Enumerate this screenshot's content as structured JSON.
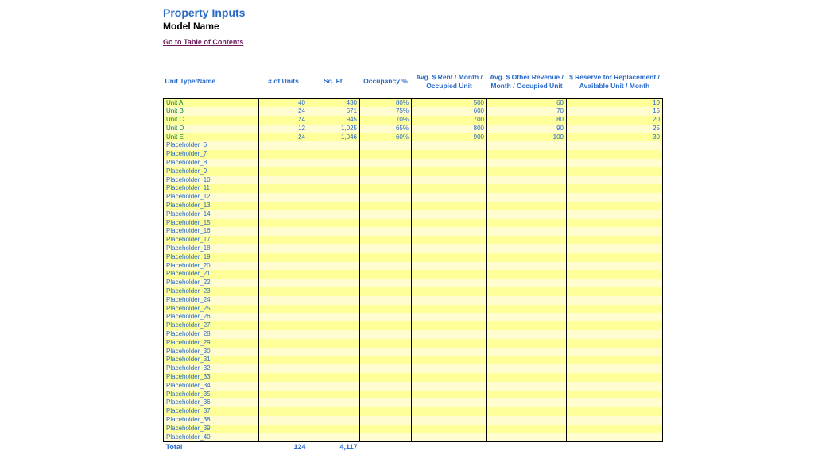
{
  "header": {
    "title": "Property Inputs",
    "subtitle": "Model Name",
    "toc_link": "Go to Table of Contents"
  },
  "columns": [
    "Unit Type/Name",
    "# of Units",
    "Sq. Ft.",
    "Occupancy %",
    "Avg. $ Rent / Month / Occupied Unit",
    "Avg. $ Other Revenue / Month / Occupied Unit",
    "$ Reserve for Replacement / Available Unit / Month"
  ],
  "rows": [
    {
      "name": "Unit A",
      "units": "40",
      "sqft": "430",
      "occ": "80%",
      "rent": "500",
      "other": "60",
      "reserve": "10",
      "is_unit": true
    },
    {
      "name": "Unit B",
      "units": "24",
      "sqft": "671",
      "occ": "75%",
      "rent": "600",
      "other": "70",
      "reserve": "15",
      "is_unit": true
    },
    {
      "name": "Unit C",
      "units": "24",
      "sqft": "945",
      "occ": "70%",
      "rent": "700",
      "other": "80",
      "reserve": "20",
      "is_unit": true
    },
    {
      "name": "Unit D",
      "units": "12",
      "sqft": "1,025",
      "occ": "65%",
      "rent": "800",
      "other": "90",
      "reserve": "25",
      "is_unit": true
    },
    {
      "name": "Unit E",
      "units": "24",
      "sqft": "1,046",
      "occ": "60%",
      "rent": "900",
      "other": "100",
      "reserve": "30",
      "is_unit": true
    },
    {
      "name": "Placeholder_6",
      "is_unit": false
    },
    {
      "name": "Placeholder_7",
      "is_unit": false
    },
    {
      "name": "Placeholder_8",
      "is_unit": false
    },
    {
      "name": "Placeholder_9",
      "is_unit": false
    },
    {
      "name": "Placeholder_10",
      "is_unit": false
    },
    {
      "name": "Placeholder_11",
      "is_unit": false
    },
    {
      "name": "Placeholder_12",
      "is_unit": false
    },
    {
      "name": "Placeholder_13",
      "is_unit": false
    },
    {
      "name": "Placeholder_14",
      "is_unit": false
    },
    {
      "name": "Placeholder_15",
      "is_unit": false
    },
    {
      "name": "Placeholder_16",
      "is_unit": false
    },
    {
      "name": "Placeholder_17",
      "is_unit": false
    },
    {
      "name": "Placeholder_18",
      "is_unit": false
    },
    {
      "name": "Placeholder_19",
      "is_unit": false
    },
    {
      "name": "Placeholder_20",
      "is_unit": false
    },
    {
      "name": "Placeholder_21",
      "is_unit": false
    },
    {
      "name": "Placeholder_22",
      "is_unit": false
    },
    {
      "name": "Placeholder_23",
      "is_unit": false
    },
    {
      "name": "Placeholder_24",
      "is_unit": false
    },
    {
      "name": "Placeholder_25",
      "is_unit": false
    },
    {
      "name": "Placeholder_26",
      "is_unit": false
    },
    {
      "name": "Placeholder_27",
      "is_unit": false
    },
    {
      "name": "Placeholder_28",
      "is_unit": false
    },
    {
      "name": "Placeholder_29",
      "is_unit": false
    },
    {
      "name": "Placeholder_30",
      "is_unit": false
    },
    {
      "name": "Placeholder_31",
      "is_unit": false
    },
    {
      "name": "Placeholder_32",
      "is_unit": false
    },
    {
      "name": "Placeholder_33",
      "is_unit": false
    },
    {
      "name": "Placeholder_34",
      "is_unit": false
    },
    {
      "name": "Placeholder_35",
      "is_unit": false
    },
    {
      "name": "Placeholder_36",
      "is_unit": false
    },
    {
      "name": "Placeholder_37",
      "is_unit": false
    },
    {
      "name": "Placeholder_38",
      "is_unit": false
    },
    {
      "name": "Placeholder_39",
      "is_unit": false
    },
    {
      "name": "Placeholder_40",
      "is_unit": false
    }
  ],
  "totals": {
    "label": "Total",
    "units": "124",
    "sqft": "4,117"
  },
  "chart_data": {
    "type": "table",
    "title": "Property Inputs",
    "columns": [
      "Unit Type/Name",
      "# of Units",
      "Sq. Ft.",
      "Occupancy %",
      "Avg. $ Rent / Month / Occupied Unit",
      "Avg. $ Other Revenue / Month / Occupied Unit",
      "$ Reserve for Replacement / Available Unit / Month"
    ],
    "series": [
      {
        "name": "Unit A",
        "values": [
          40,
          430,
          80,
          500,
          60,
          10
        ]
      },
      {
        "name": "Unit B",
        "values": [
          24,
          671,
          75,
          600,
          70,
          15
        ]
      },
      {
        "name": "Unit C",
        "values": [
          24,
          945,
          70,
          700,
          80,
          20
        ]
      },
      {
        "name": "Unit D",
        "values": [
          12,
          1025,
          65,
          800,
          90,
          25
        ]
      },
      {
        "name": "Unit E",
        "values": [
          24,
          1046,
          60,
          900,
          100,
          30
        ]
      }
    ],
    "totals": {
      "units": 124,
      "sqft": 4117
    }
  }
}
